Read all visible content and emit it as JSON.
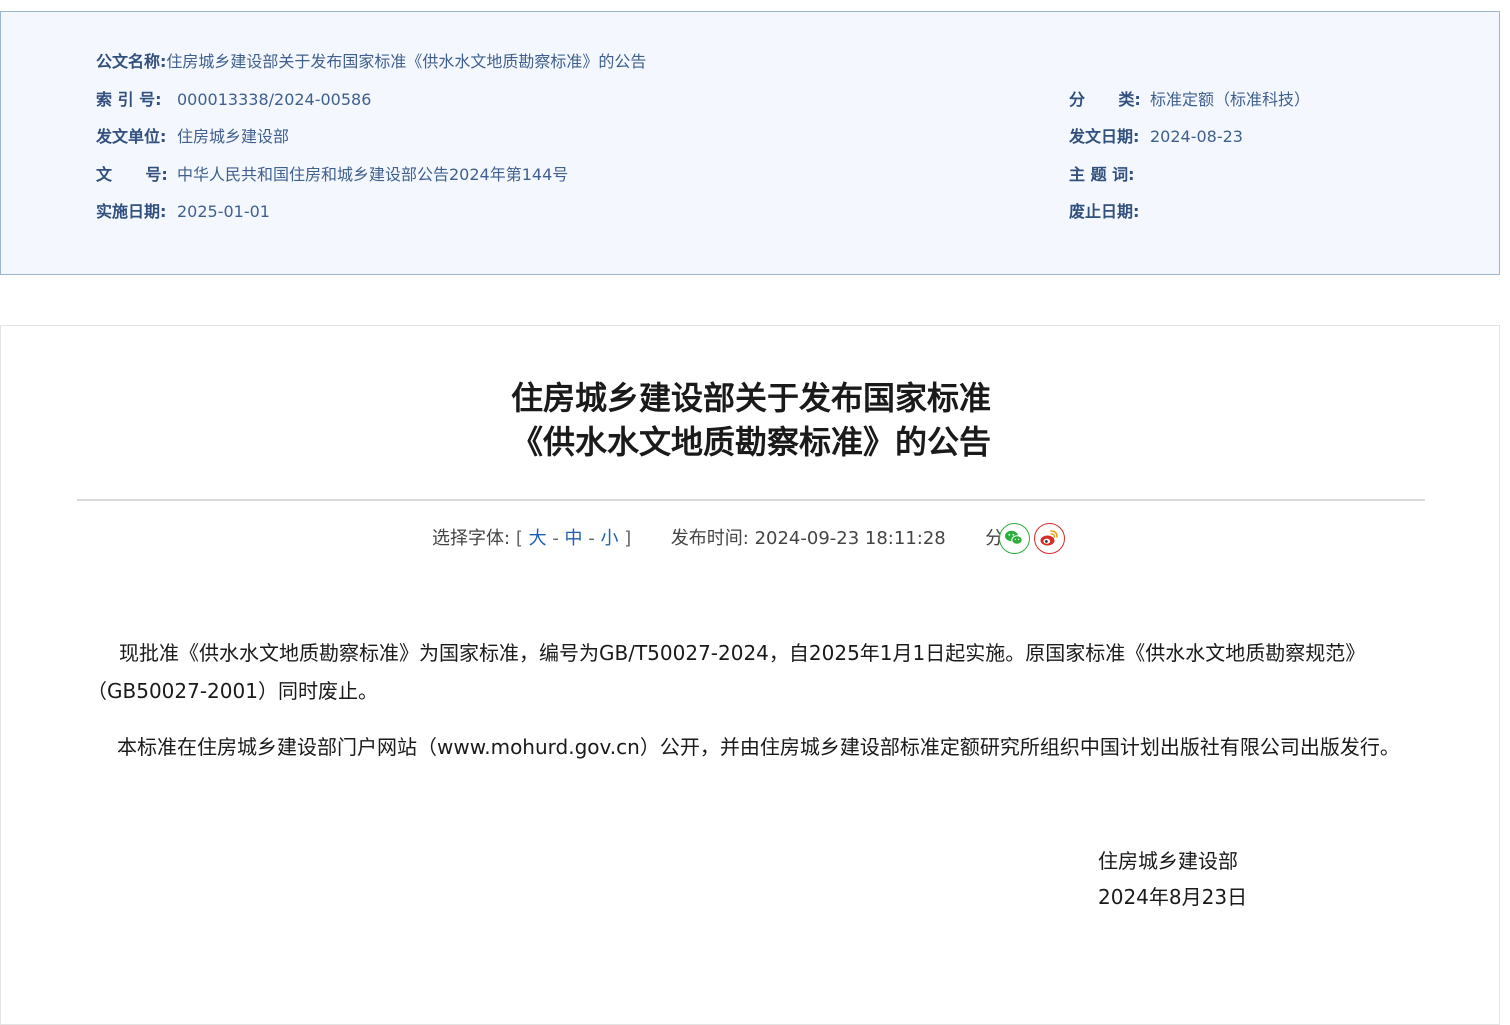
{
  "meta": {
    "doc_name": {
      "label": "公文名称:",
      "value": "住房城乡建设部关于发布国家标准《供水水文地质勘察标准》的公告"
    },
    "index_no": {
      "label": "索 引 号:",
      "value": "000013338/2024-00586"
    },
    "category": {
      "label": "分      类:",
      "value": "标准定额（标准科技）"
    },
    "issuer": {
      "label": "发文单位:",
      "value": "住房城乡建设部"
    },
    "issue_date": {
      "label": "发文日期:",
      "value": "2024-08-23"
    },
    "doc_no": {
      "label": "文      号:",
      "value": "中华人民共和国住房和城乡建设部公告2024年第144号"
    },
    "subject_words": {
      "label": "主 题 词:",
      "value": ""
    },
    "effective_date": {
      "label": "实施日期:",
      "value": "2025-01-01"
    },
    "repeal_date": {
      "label": "废止日期:",
      "value": ""
    }
  },
  "article": {
    "title_line1": "住房城乡建设部关于发布国家标准",
    "title_line2": "《供水水文地质勘察标准》的公告",
    "toolbar": {
      "font_label": "选择字体:",
      "bracket_open": "[",
      "font_large": "大",
      "font_medium": "中",
      "font_small": "小",
      "dash": "-",
      "bracket_close": "]",
      "publish_label": "发布时间:",
      "publish_time": "2024-09-23 18:11:28",
      "share_label": "分享:"
    },
    "para1_line1": "现批准《供水水文地质勘察标准》为国家标准，编号为GB/T50027-2024，自2025年1月1日起实施。原国家标准《供水水文地质勘察规范》",
    "para1_line2": "（GB50027-2001）同时废止。",
    "para2": "本标准在住房城乡建设部门户网站（www.mohurd.gov.cn）公开，并由住房城乡建设部标准定额研究所组织中国计划出版社有限公司出版发行。",
    "signature_org": "住房城乡建设部",
    "signature_date": "2024年8月23日"
  },
  "icons": {
    "wechat": "wechat-icon",
    "weibo": "weibo-icon"
  },
  "colors": {
    "meta_background": "#f4f8fe",
    "meta_label": "#32507e",
    "link_blue": "#1f5fb5",
    "wechat_green": "#2bae3c",
    "weibo_red": "#d52b2b"
  }
}
